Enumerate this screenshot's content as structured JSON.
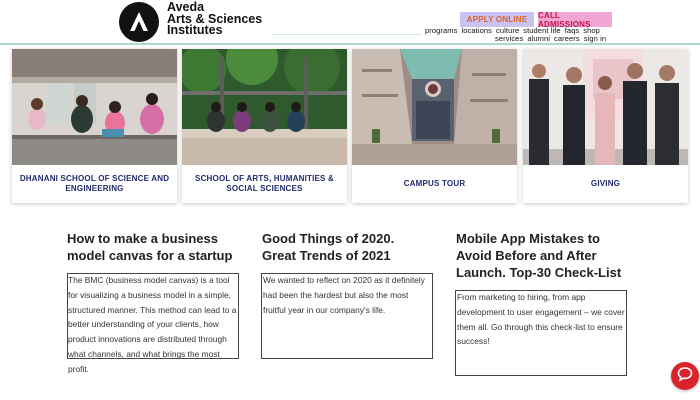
{
  "header": {
    "logo_line1": "Aveda",
    "logo_line2": "Arts & Sciences",
    "logo_line3": "Institutes",
    "apply_label": "APPLY ONLINE",
    "call_label": "CALL ADMISSIONS",
    "nav_row1": [
      "programs",
      "locations",
      "culture",
      "student life",
      "faqs",
      "shop"
    ],
    "nav_row2": [
      "services",
      "alumni",
      "careers",
      "sign in"
    ],
    "colors": {
      "apply_bg": "#c9c3f5",
      "apply_text": "#d9632b",
      "call_bg": "#f0a7d6",
      "call_text": "#c81446",
      "rule": "#a8dccd"
    }
  },
  "cards": [
    {
      "label": "DHANANI SCHOOL OF SCIENCE AND ENGINEERING"
    },
    {
      "label": "SCHOOL OF ARTS, HUMANITIES & SOCIAL SCIENCES"
    },
    {
      "label": "CAMPUS TOUR"
    },
    {
      "label": "GIVING"
    }
  ],
  "posts": [
    {
      "title": "How to make a business model canvas for a startup",
      "lines": [
        "The BMC (business model canvas) is a tool",
        "for visualizing a business model in a simple,",
        "structured manner. This method can lead to a",
        "better understanding of your clients, how",
        "product innovations are distributed through",
        "what channels, and what brings the most",
        "profit."
      ]
    },
    {
      "title": "Good Things of 2020. Great Trends of 2021",
      "lines": [
        "We wanted to reflect on 2020 as it definitely",
        "had been the hardest but also the most",
        "fruitful year in our company's life."
      ]
    },
    {
      "title": "Mobile App Mistakes to Avoid Before and After Launch. Top-30 Check-List",
      "lines": [
        "From marketing to hiring, from app",
        "development to user engagement – we cover",
        "them all. Go through this check-list to ensure",
        "success!"
      ]
    }
  ],
  "chat": {
    "icon": "chat-bubble-icon",
    "color": "#d8242a"
  }
}
